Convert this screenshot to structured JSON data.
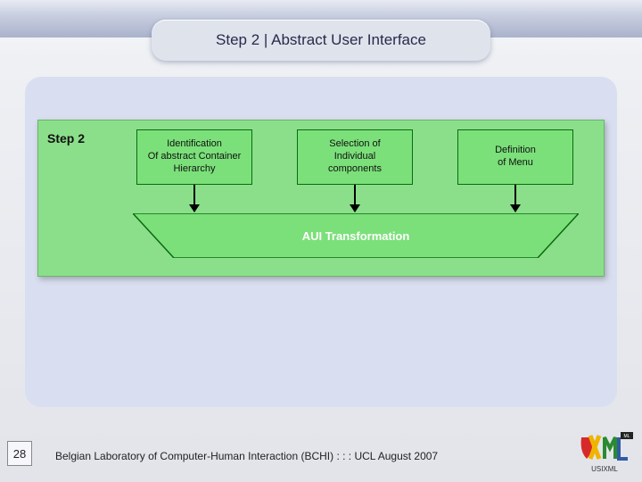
{
  "header": {
    "title": "Step 2 | Abstract User Interface"
  },
  "diagram": {
    "step_label": "Step 2",
    "boxes": [
      {
        "text": "Identification\nOf abstract Container\nHierarchy"
      },
      {
        "text": "Selection of\nIndividual\ncomponents"
      },
      {
        "text": "Definition\nof Menu"
      }
    ],
    "output": "AUI Transformation"
  },
  "footer": {
    "page": "28",
    "text": "Belgian Laboratory of Computer-Human Interaction (BCHI) : : : UCL  August 2007"
  },
  "logo": {
    "name": "UsiXML"
  },
  "colors": {
    "panel": "#d9dff0",
    "diagram_bg": "#8bdf8a",
    "box_bg": "#7be07a",
    "box_border": "#0a6b0e"
  }
}
